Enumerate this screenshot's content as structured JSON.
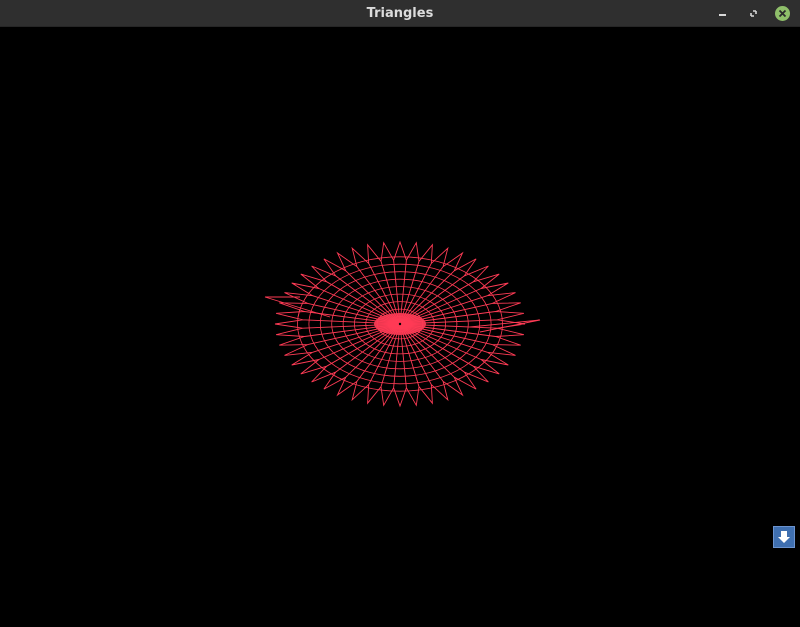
{
  "window": {
    "title": "Triangles"
  },
  "controls": {
    "minimize_icon": "minimize-icon",
    "maximize_icon": "maximize-icon",
    "close_icon": "close-icon",
    "scroll_down_icon": "arrow-down-icon"
  },
  "colors": {
    "titlebar": "#2f2f2f",
    "title_text": "#dcdcdc",
    "canvas_bg": "#000000",
    "stroke": "#ff3b55",
    "close_button": "#8fbf6a",
    "scroll_button": "#3f6fb0"
  }
}
